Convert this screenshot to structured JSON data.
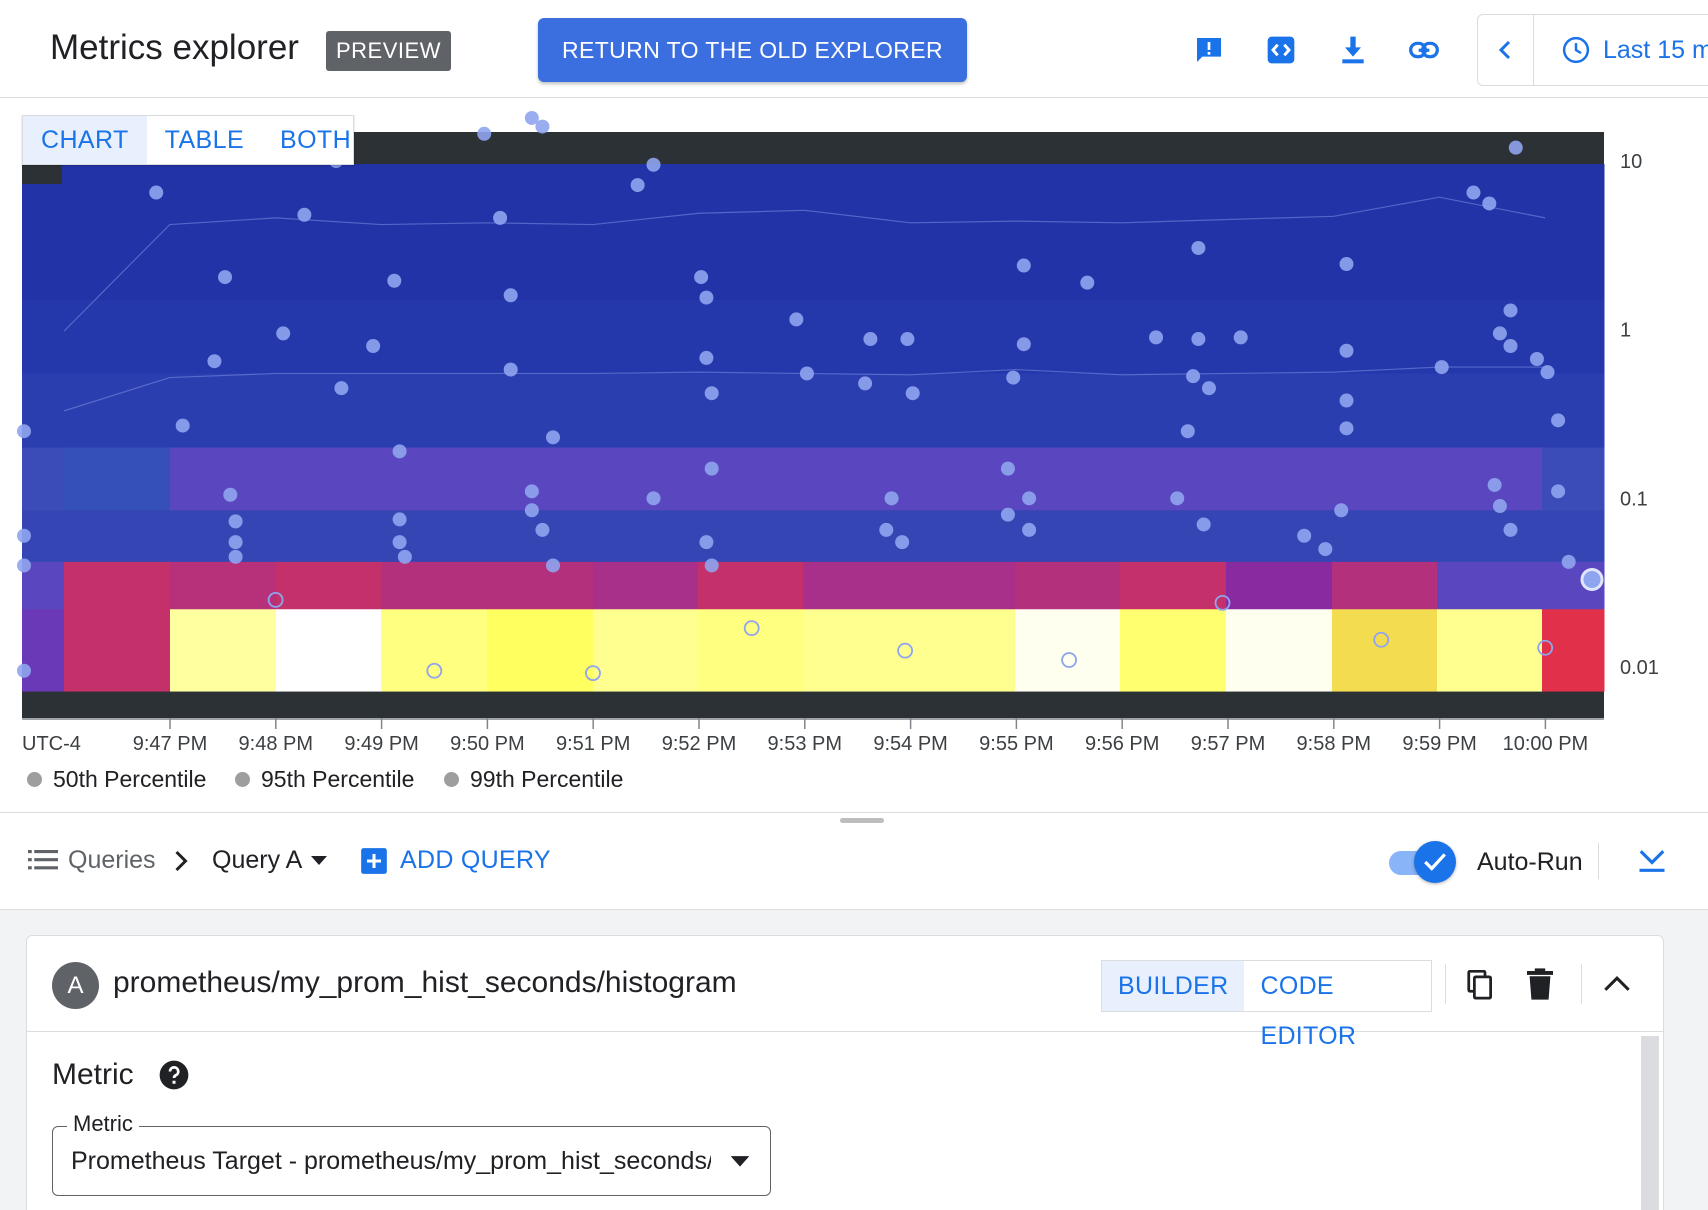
{
  "header": {
    "title": "Metrics explorer",
    "badge": "PREVIEW",
    "return_button": "RETURN TO THE OLD EXPLORER",
    "icons": [
      "feedback-icon",
      "code-icon",
      "download-icon",
      "link-icon"
    ],
    "time_range": "Last 15 m"
  },
  "view_toggle": {
    "chart": "CHART",
    "table": "TABLE",
    "both": "BOTH",
    "selected": "CHART"
  },
  "chart_data": {
    "type": "heatmap",
    "timezone": "UTC-4",
    "x_ticks": [
      "9:47 PM",
      "9:48 PM",
      "9:49 PM",
      "9:50 PM",
      "9:51 PM",
      "9:52 PM",
      "9:53 PM",
      "9:54 PM",
      "9:55 PM",
      "9:56 PM",
      "9:57 PM",
      "9:58 PM",
      "9:59 PM",
      "10:00 PM"
    ],
    "y_ticks": [
      "10",
      "1",
      "0.1",
      "0.01"
    ],
    "y_scale": "log",
    "ylim": [
      0.006,
      15
    ],
    "legend": [
      "50th Percentile",
      "95th Percentile",
      "99th Percentile"
    ],
    "legend_placement": "bottom-left",
    "colors": {
      "background": "#2c3135",
      "low": "#2233a8",
      "mid": "#5a47c0",
      "high": "#c4306a",
      "peak": "#ffff66",
      "point": "#8fa4ee"
    }
  },
  "queries_bar": {
    "queries_label": "Queries",
    "query_selector": "Query A",
    "add_query": "ADD QUERY",
    "auto_run_label": "Auto-Run",
    "auto_run": true
  },
  "query_card": {
    "letter": "A",
    "name": "prometheus/my_prom_hist_seconds/histogram",
    "builder": "BUILDER",
    "code_editor": "CODE EDITOR",
    "mode_selected": "BUILDER",
    "metric_section": "Metric",
    "metric_field_label": "Metric",
    "metric_value": "Prometheus Target - prometheus/my_prom_hist_seconds/histogram"
  }
}
